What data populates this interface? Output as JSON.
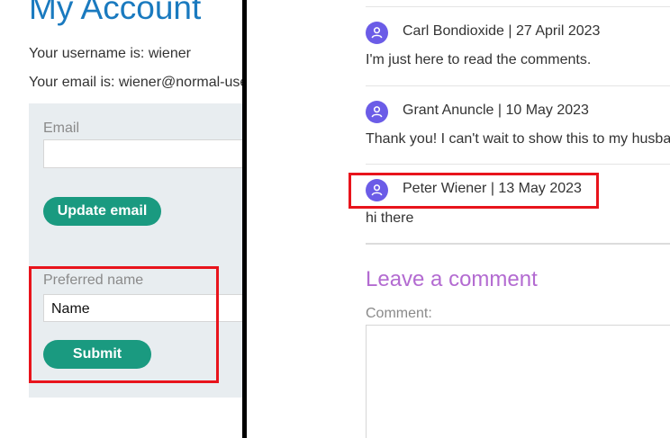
{
  "account": {
    "title": "My Account",
    "username_line": "Your username is: wiener",
    "email_line": "Your email is: wiener@normal-user.net",
    "email_label": "Email",
    "email_value": "",
    "update_email_label": "Update email",
    "preferred_name_label": "Preferred name",
    "preferred_name_value": "Name",
    "submit_label": "Submit"
  },
  "comments": [
    {
      "author_date": "Carl Bondioxide | 27 April 2023",
      "text": "I'm just here to read the comments."
    },
    {
      "author_date": "Grant Anuncle | 10 May 2023",
      "text": "Thank you! I can't wait to show this to my husband."
    },
    {
      "author_date": "Peter Wiener | 13 May 2023",
      "text": "hi there"
    }
  ],
  "leave_comment": {
    "heading": "Leave a comment",
    "comment_label": "Comment:",
    "comment_value": ""
  },
  "icons": {
    "avatar": "user-avatar-icon"
  },
  "colors": {
    "title": "#1a7abf",
    "button": "#1a9a80",
    "highlight": "#e8141c",
    "avatar": "#6b5ce7",
    "heading": "#b36bd1"
  }
}
